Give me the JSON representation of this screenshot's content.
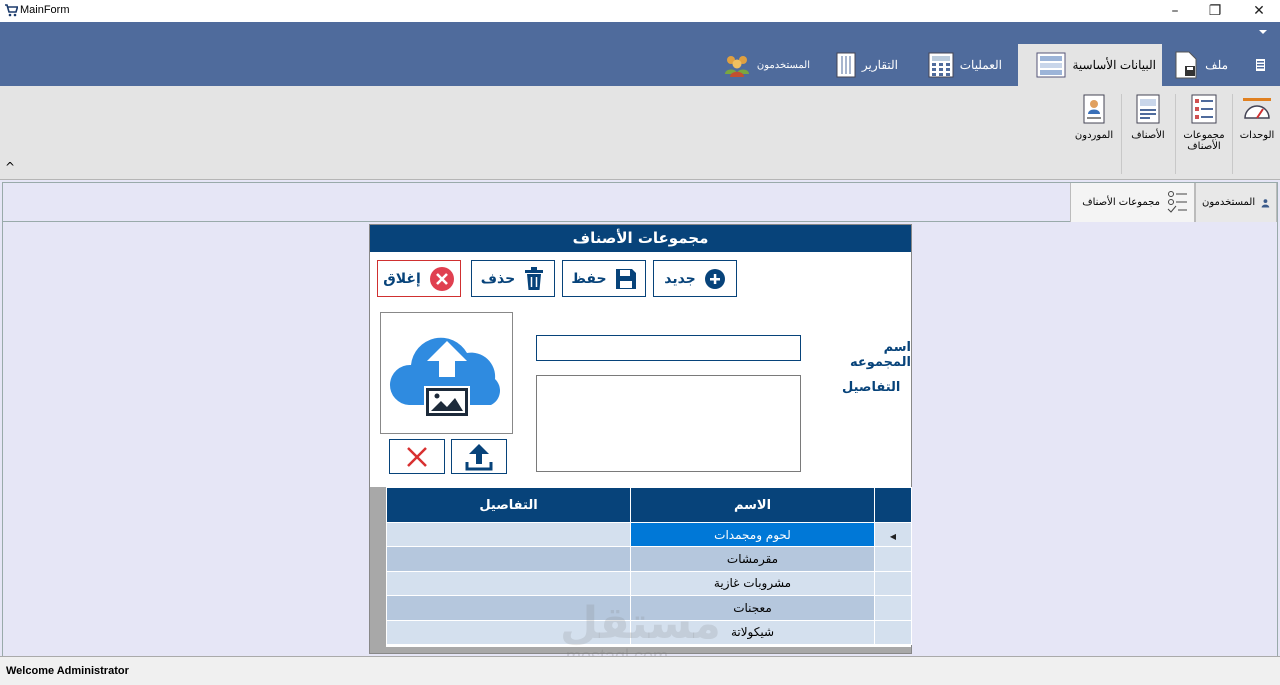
{
  "window": {
    "title": "MainForm"
  },
  "ribbon": {
    "tabs": [
      {
        "label": "ملف"
      },
      {
        "label": "البيانات الأساسية"
      },
      {
        "label": "العمليات"
      },
      {
        "label": "التقارير"
      },
      {
        "label": "المستخدمون"
      }
    ],
    "buttons": [
      {
        "label": "الوحدات"
      },
      {
        "label": "مجموعات الأصناف"
      },
      {
        "label": "الأصناف"
      },
      {
        "label": "الموردون"
      }
    ],
    "collapse_glyph": "^"
  },
  "doc_tabs": [
    {
      "label": "المستخدمون"
    },
    {
      "label": "مجموعات الأصناف"
    }
  ],
  "form": {
    "title": "مجموعات الأصناف",
    "toolbar": {
      "new": "جديد",
      "save": "حفظ",
      "delete": "حذف",
      "close": "إغلاق"
    },
    "group_name_label": "اسم المجموعه",
    "group_name_value": "",
    "details_label": "التفاصيل",
    "details_value": "",
    "grid": {
      "columns": [
        "الاسم",
        "التفاصيل"
      ],
      "rows": [
        {
          "name": "لحوم ومجمدات",
          "details": ""
        },
        {
          "name": "مقرمشات",
          "details": ""
        },
        {
          "name": "مشروبات غازية",
          "details": ""
        },
        {
          "name": "معجنات",
          "details": ""
        },
        {
          "name": "شيكولاتة",
          "details": ""
        }
      ],
      "selected_row": 0
    }
  },
  "statusbar": {
    "text": "Welcome Administrator"
  },
  "watermark": {
    "line1": "مستقل",
    "line2": "mostaql.com"
  },
  "colors": {
    "ribbon_blue": "#4f6b9c",
    "form_navy": "#07437a",
    "selection_blue": "#0078d7",
    "close_red": "#d03030"
  }
}
